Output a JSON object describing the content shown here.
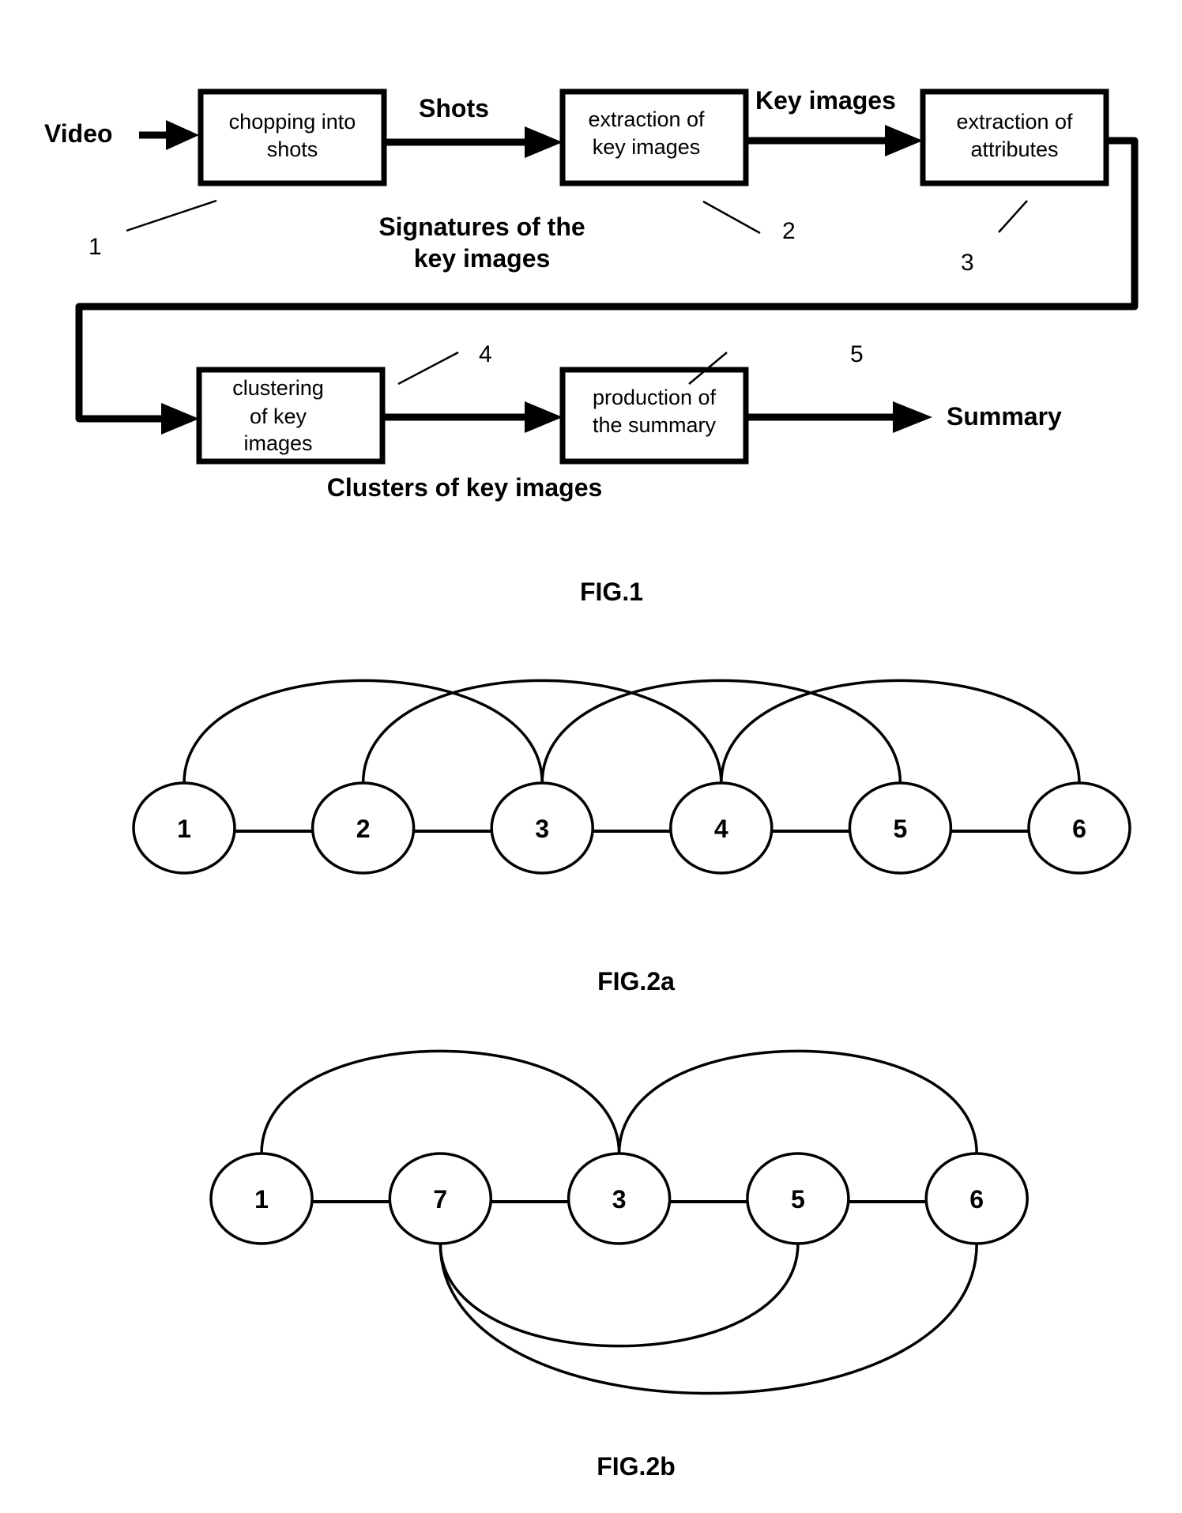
{
  "fig1": {
    "caption": "FIG.1",
    "input_label": "Video",
    "output_label": "Summary",
    "boxes": [
      {
        "id": 1,
        "line1": "chopping into",
        "line2": "shots",
        "line3": "",
        "ref": "1"
      },
      {
        "id": 2,
        "line1": "extraction of",
        "line2": "key images",
        "line3": "",
        "ref": "2"
      },
      {
        "id": 3,
        "line1": "extraction of",
        "line2": "attributes",
        "line3": "",
        "ref": "3"
      },
      {
        "id": 4,
        "line1": "clustering",
        "line2": "of key",
        "line3": "images",
        "ref": "4"
      },
      {
        "id": 5,
        "line1": "production of",
        "line2": "the summary",
        "line3": "",
        "ref": "5"
      }
    ],
    "flow_labels": {
      "shots": "Shots",
      "key_images": "Key images",
      "signatures_line1": "Signatures of the",
      "signatures_line2": "key images",
      "clusters": "Clusters of key images"
    }
  },
  "fig2a": {
    "caption": "FIG.2a",
    "nodes": [
      "1",
      "2",
      "3",
      "4",
      "5",
      "6"
    ],
    "edges_adjacent": [
      [
        "1",
        "2"
      ],
      [
        "2",
        "3"
      ],
      [
        "3",
        "4"
      ],
      [
        "4",
        "5"
      ],
      [
        "5",
        "6"
      ]
    ],
    "edges_arcs_above": [
      [
        "1",
        "3"
      ],
      [
        "2",
        "4"
      ],
      [
        "3",
        "5"
      ],
      [
        "4",
        "6"
      ]
    ]
  },
  "fig2b": {
    "caption": "FIG.2b",
    "nodes": [
      "1",
      "7",
      "3",
      "5",
      "6"
    ],
    "edges_adjacent": [
      [
        "1",
        "7"
      ],
      [
        "7",
        "3"
      ],
      [
        "3",
        "5"
      ],
      [
        "5",
        "6"
      ]
    ],
    "edges_arcs_above": [
      [
        "1",
        "3"
      ],
      [
        "3",
        "6"
      ]
    ],
    "edges_arcs_below": [
      [
        "7",
        "5"
      ],
      [
        "7",
        "6"
      ]
    ]
  }
}
